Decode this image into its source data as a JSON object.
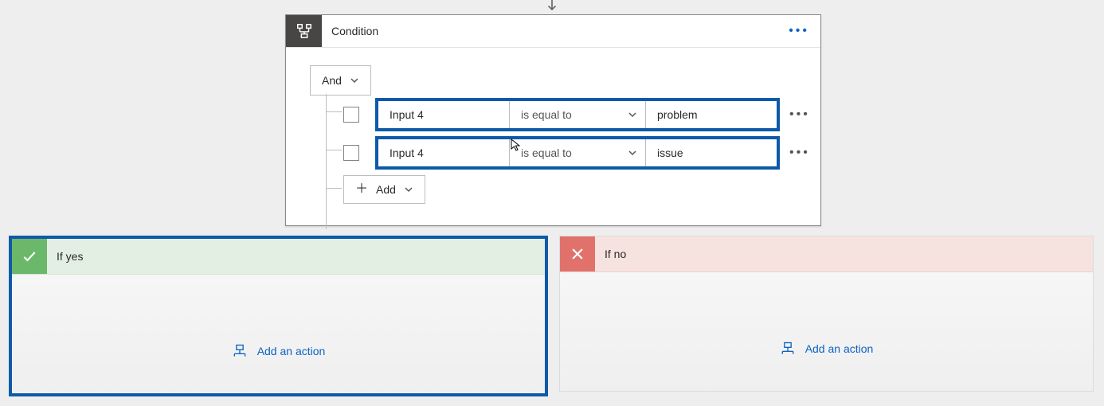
{
  "condition": {
    "title": "Condition",
    "logic_operator": "And",
    "add_label": "Add",
    "rows": [
      {
        "left": "Input 4",
        "op": "is equal to",
        "right": "problem"
      },
      {
        "left": "Input 4",
        "op": "is equal to",
        "right": "issue"
      }
    ]
  },
  "branches": {
    "yes": {
      "label": "If yes",
      "add_action_label": "Add an action"
    },
    "no": {
      "label": "If no",
      "add_action_label": "Add an action"
    }
  }
}
